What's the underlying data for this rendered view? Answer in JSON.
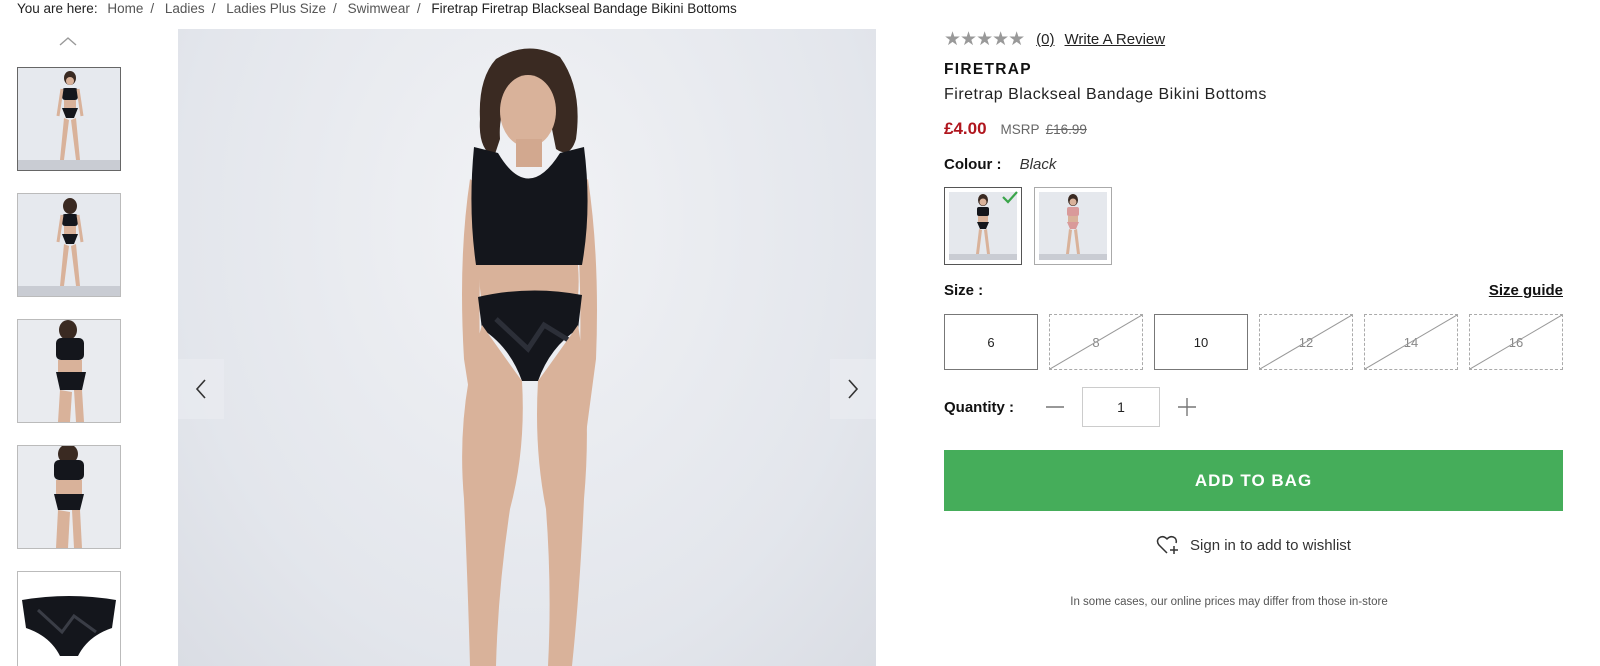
{
  "breadcrumb": {
    "lead": "You are here:",
    "items": [
      "Home",
      "Ladies",
      "Ladies Plus Size",
      "Swimwear"
    ],
    "current": "Firetrap Firetrap Blackseal Bandage Bikini Bottoms"
  },
  "icons": {
    "thumb_up": "chevron-up-icon",
    "prev": "chevron-left-icon",
    "next": "chevron-right-icon",
    "check": "check-icon",
    "minus": "minus-icon",
    "plus": "plus-icon",
    "wishlist": "heart-plus-icon"
  },
  "product": {
    "stars": "★★★★★",
    "review_count": "(0)",
    "write_review": "Write A Review",
    "brand": "FIRETRAP",
    "title": "Firetrap Blackseal Bandage Bikini Bottoms",
    "price": "£4.00",
    "msrp_label": "MSRP",
    "msrp": "£16.99",
    "colour_label": "Colour :",
    "colour_value": "Black",
    "size_label": "Size :",
    "size_guide": "Size guide",
    "sizes": [
      {
        "label": "6",
        "available": true
      },
      {
        "label": "8",
        "available": false
      },
      {
        "label": "10",
        "available": true
      },
      {
        "label": "12",
        "available": false
      },
      {
        "label": "14",
        "available": false
      },
      {
        "label": "16",
        "available": false
      }
    ],
    "quantity_label": "Quantity :",
    "quantity": "1",
    "add_to_bag": "ADD TO BAG",
    "wishlist": "Sign in to add to wishlist",
    "disclaimer": "In some cases, our online prices may differ from those in-store"
  },
  "colors": {
    "price": "#b0161e",
    "add_to_bag": "#45ad5a",
    "check": "#3aa54a",
    "garment_black": "#14161c",
    "garment_pink": "#d99a9a",
    "skin": "#d9b29a"
  }
}
